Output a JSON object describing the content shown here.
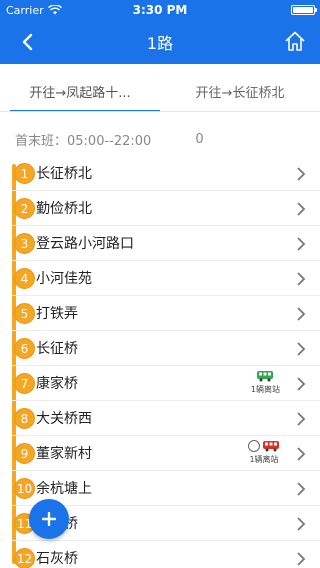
{
  "status_bar": {
    "carrier": "Carrier",
    "time": "3:30 PM"
  },
  "nav": {
    "title": "1路"
  },
  "tabs": [
    {
      "label": "开往→凤起路十..."
    },
    {
      "label": "开往→长征桥北"
    }
  ],
  "schedule": {
    "text": "首末班：05:00--22:00",
    "count": "0"
  },
  "stops": [
    {
      "num": "1",
      "name": "长征桥北"
    },
    {
      "num": "2",
      "name": "勤俭桥北"
    },
    {
      "num": "3",
      "name": "登云路小河路口"
    },
    {
      "num": "4",
      "name": "小河佳苑"
    },
    {
      "num": "5",
      "name": "打铁弄"
    },
    {
      "num": "6",
      "name": "长征桥"
    },
    {
      "num": "7",
      "name": "康家桥",
      "bus_label": "1辆离站"
    },
    {
      "num": "8",
      "name": "大关桥西"
    },
    {
      "num": "9",
      "name": "董家新村",
      "bus_label": "1辆离站"
    },
    {
      "num": "10",
      "name": "余杭塘上"
    },
    {
      "num": "11",
      "name": "桥"
    },
    {
      "num": "12",
      "name": "石灰桥"
    }
  ],
  "colors": {
    "primary": "#1a73e8",
    "accent": "#f5a623"
  }
}
